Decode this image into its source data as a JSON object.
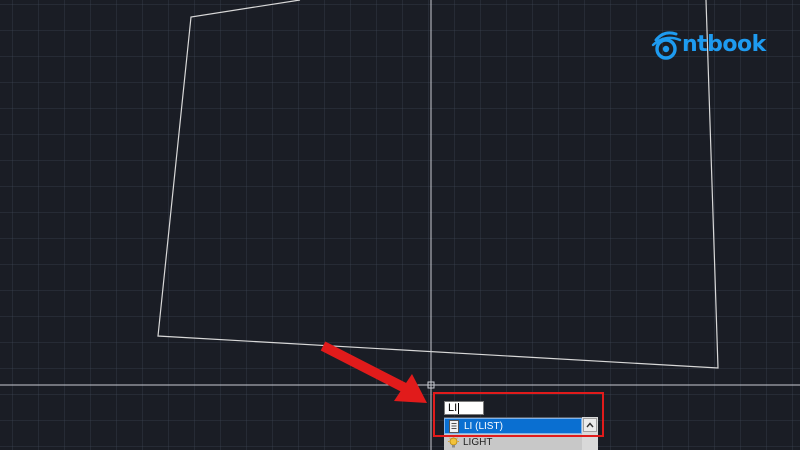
{
  "app": {
    "name": "AutoCAD drawing workspace"
  },
  "logo": {
    "text": "ntbook",
    "color": "#1e9bf0",
    "icon": "eye-logo-icon"
  },
  "command_line": {
    "typed_value": "LI"
  },
  "autocomplete": {
    "items": [
      {
        "label": "LI (LIST)",
        "icon": "list-command-icon",
        "selected": true
      },
      {
        "label": "LIGHT",
        "icon": "light-bulb-icon",
        "selected": false
      }
    ],
    "scroll_up_icon": "chevron-up-icon"
  },
  "annotation": {
    "color": "#e11b1b"
  },
  "colors": {
    "canvas_background": "#1a1d25",
    "drawing_lines": "#d8d8d8",
    "selection_blue": "#0a6fd1"
  }
}
